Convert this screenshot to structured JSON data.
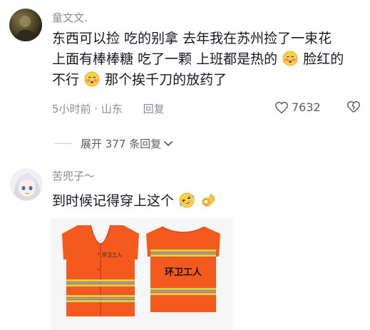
{
  "comment1": {
    "username": "童文文.",
    "line1": "东西可以捡 吃的别拿 去年我在苏州捡了一束花",
    "line2a": "上面有棒棒糖 吃了一颗 上班都是热的",
    "line2b": " 脸红的",
    "line3a": "不行",
    "line3b": " 那个挨千刀的放药了",
    "time_location": "5小时前 · 山东",
    "reply_label": "回复",
    "like_count": "7632"
  },
  "expand_replies": {
    "label": "展开 377 条回复"
  },
  "comment2": {
    "username": "苦兜子～",
    "text": "到时候记得穿上这个",
    "image": {
      "vest_text_front": "环卫工人",
      "vest_text_back": "环卫工人"
    }
  },
  "colors": {
    "vest_orange": "#f4591e",
    "reflective_stripe": "#c9d650",
    "muted_text": "#8a8b91"
  }
}
